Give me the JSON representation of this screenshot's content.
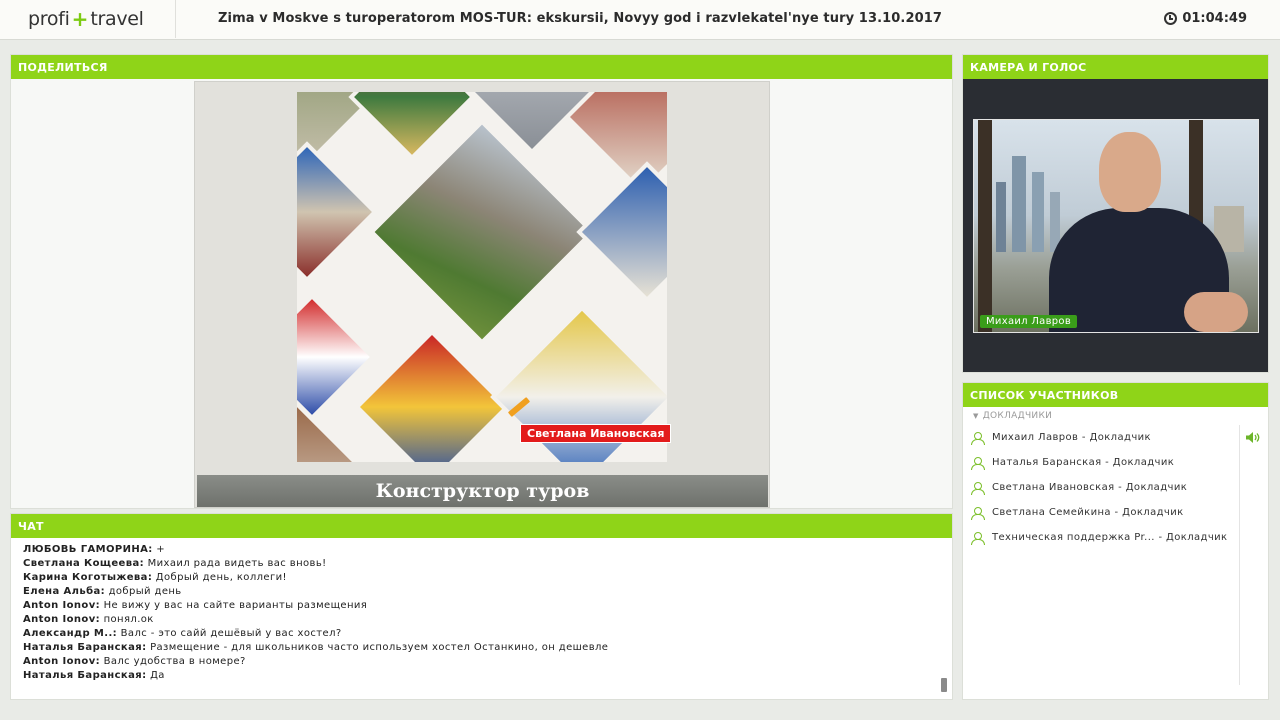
{
  "header": {
    "logo_left": "profi",
    "logo_plus": "+",
    "logo_right": "travel",
    "title": "Zima v Moskve s turoperatorom MOS-TUR: ekskursii, Novyy god i razvlekatel'nye tury 13.10.2017",
    "timer": "01:04:49"
  },
  "share": {
    "header": "ПОДЕЛИТЬСЯ",
    "slide_caption": "Конструктор туров",
    "pointer_label": "Светлана Ивановская"
  },
  "camera": {
    "header": "КАМЕРА И ГОЛОС",
    "speaker_name": "Михаил Лавров"
  },
  "participants": {
    "header": "СПИСОК УЧАСТНИКОВ",
    "group": "ДОКЛАДЧИКИ",
    "items": [
      {
        "label": "Михаил Лавров  - Докладчик"
      },
      {
        "label": "Наталья Баранская  - Докладчик"
      },
      {
        "label": "Светлана Ивановская  - Докладчик"
      },
      {
        "label": "Светлана Семейкина  - Докладчик"
      },
      {
        "label": "Техническая поддержка Pr...  - Докладчик"
      }
    ]
  },
  "chat": {
    "header": "ЧАТ",
    "messages": [
      {
        "who": "ЛЮБОВЬ ГАМОРИНА:",
        "text": " +"
      },
      {
        "who": "Светлана Кощеева:",
        "text": " Михаил рада видеть вас вновь!"
      },
      {
        "who": "Карина Коготыжева:",
        "text": " Добрый день, коллеги!"
      },
      {
        "who": "Елена Альба:",
        "text": " добрый день"
      },
      {
        "who": "Anton Ionov:",
        "text": " Не вижу у вас на сайте варианты размещения"
      },
      {
        "who": "Anton Ionov:",
        "text": " понял.ок"
      },
      {
        "who": "Александр М..:",
        "text": " Валс - это сайй дешёвый у вас хостел?"
      },
      {
        "who": "Наталья Баранская:",
        "text": " Размещение - для школьников часто используем хостел Останкино, он дешевле"
      },
      {
        "who": "Anton Ionov:",
        "text": " Валс удобства в номере?"
      },
      {
        "who": "Наталья Баранская:",
        "text": " Да"
      }
    ]
  },
  "colors": {
    "accent": "#8fd418",
    "pointer": "#e31b1b",
    "speaker_badge": "#3a9d1a"
  }
}
